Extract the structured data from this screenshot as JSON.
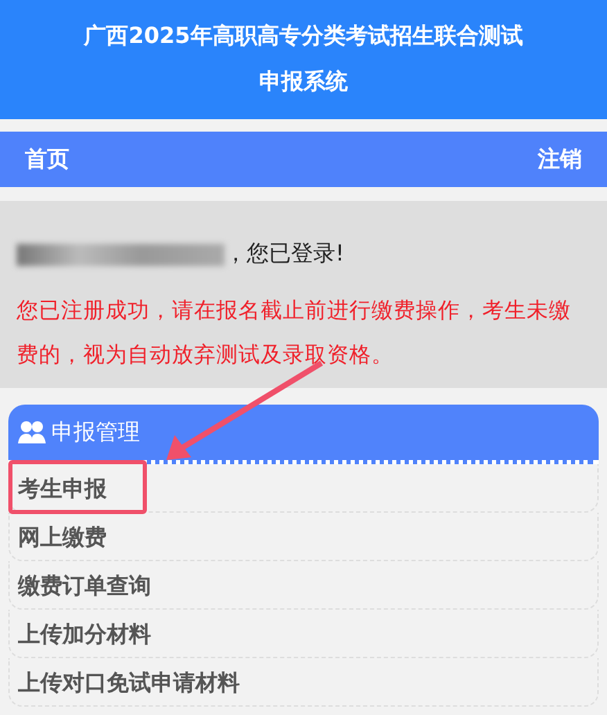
{
  "header": {
    "title": "广西2025年高职高专分类考试招生联合测试",
    "subtitle": "申报系统"
  },
  "nav": {
    "items": [
      "首页",
      "注销"
    ]
  },
  "notice": {
    "greeting": "，您已登录!",
    "message": "您已注册成功，请在报名截止前进行缴费操作，考生未缴费的，视为自动放弃测试及录取资格。"
  },
  "panel": {
    "title": "申报管理",
    "items": [
      {
        "label": "考生申报",
        "highlighted": true
      },
      {
        "label": "网上缴费",
        "highlighted": false
      },
      {
        "label": "缴费订单查询",
        "highlighted": false
      },
      {
        "label": "上传加分材料",
        "highlighted": false
      },
      {
        "label": "上传对口免试申请材料",
        "highlighted": false
      }
    ]
  }
}
